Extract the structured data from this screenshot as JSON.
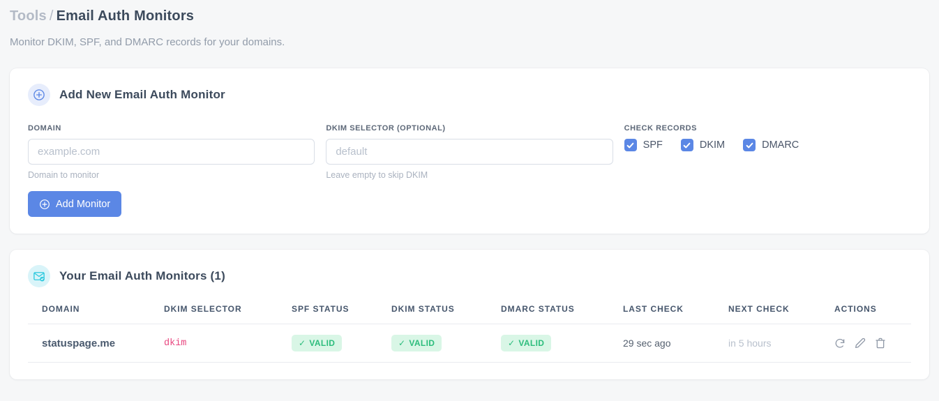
{
  "page": {
    "breadcrumb": {
      "parent": "Tools",
      "separator": "/",
      "current": "Email Auth Monitors"
    },
    "subtitle": "Monitor DKIM, SPF, and DMARC records for your domains."
  },
  "add_form": {
    "title": "Add New Email Auth Monitor",
    "domain_field": {
      "label": "DOMAIN",
      "placeholder": "example.com",
      "value": "",
      "hint": "Domain to monitor"
    },
    "dkim_field": {
      "label": "DKIM SELECTOR (OPTIONAL)",
      "placeholder": "default",
      "value": "",
      "hint": "Leave empty to skip DKIM"
    },
    "check_records": {
      "label": "CHECK RECORDS",
      "options": [
        {
          "label": "SPF",
          "checked": true
        },
        {
          "label": "DKIM",
          "checked": true
        },
        {
          "label": "DMARC",
          "checked": true
        }
      ]
    },
    "submit_label": "Add Monitor"
  },
  "monitors": {
    "title": "Your Email Auth Monitors (1)",
    "count": 1,
    "table": {
      "headers": [
        "DOMAIN",
        "DKIM SELECTOR",
        "SPF STATUS",
        "DKIM STATUS",
        "DMARC STATUS",
        "LAST CHECK",
        "NEXT CHECK",
        "ACTIONS"
      ],
      "rows": [
        {
          "domain": "statuspage.me",
          "dkim_selector": "dkim",
          "spf_status": "VALID",
          "dkim_status": "VALID",
          "dmarc_status": "VALID",
          "last_check": "29 sec ago",
          "next_check": "in 5 hours"
        }
      ]
    }
  },
  "icons": {
    "valid_check": "✓"
  },
  "colors": {
    "accent_blue": "#5b87e5",
    "accent_cyan": "#2ec9de",
    "badge_green_bg": "#d9f6e6",
    "badge_green_text": "#2dbd7d",
    "code_pink": "#e84880",
    "page_bg": "#f6f7f8"
  }
}
